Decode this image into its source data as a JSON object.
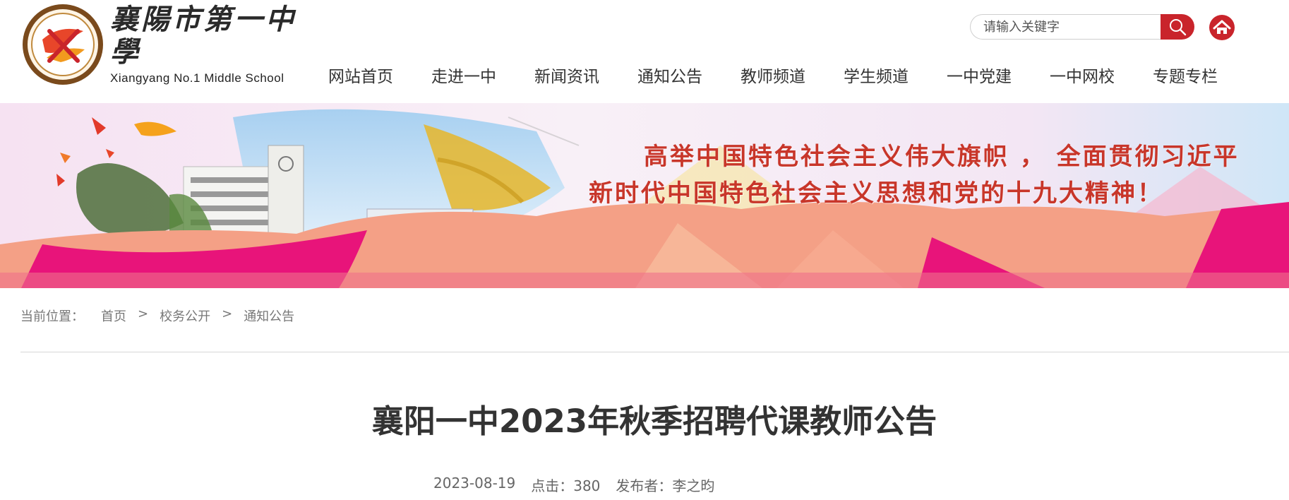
{
  "header": {
    "logo": {
      "name_cn": "襄陽市第一中學",
      "name_en": "Xiangyang No.1 Middle School"
    },
    "search": {
      "placeholder": "请输入关键字",
      "button_icon": "search-icon"
    },
    "home_icon": "home-icon",
    "accent_color": "#c9242b"
  },
  "nav": {
    "items": [
      {
        "label": "网站首页"
      },
      {
        "label": "走进一中"
      },
      {
        "label": "新闻资讯"
      },
      {
        "label": "通知公告"
      },
      {
        "label": "教师频道"
      },
      {
        "label": "学生频道"
      },
      {
        "label": "一中党建"
      },
      {
        "label": "一中网校"
      },
      {
        "label": "专题专栏"
      }
    ]
  },
  "banner": {
    "slogan_line1": "高举中国特色社会主义伟大旗帜 ， 全面贯彻习近平",
    "slogan_line2": "新时代中国特色社会主义思想和党的十九大精神！",
    "slogan_color": "#c8362a"
  },
  "breadcrumb": {
    "label": "当前位置：",
    "items": [
      "首页",
      "校务公开",
      "通知公告"
    ],
    "separator": ">"
  },
  "article": {
    "title": "襄阳一中2023年秋季招聘代课教师公告",
    "date": "2023-08-19",
    "clicks": "点击：380",
    "publisher": "发布者：李之昀"
  }
}
